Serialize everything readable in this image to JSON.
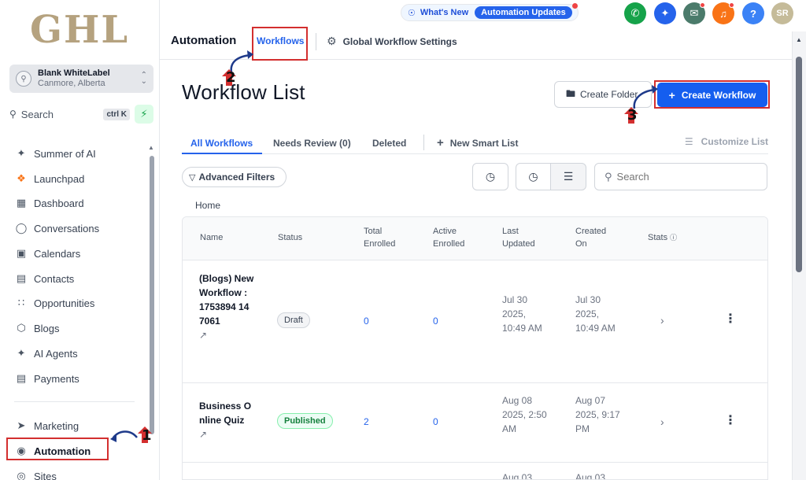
{
  "sidebar": {
    "logo": "GHL",
    "account": {
      "name": "Blank WhiteLabel",
      "location": "Canmore, Alberta"
    },
    "search": {
      "label": "Search",
      "shortcut": "ctrl K"
    },
    "items": [
      {
        "label": "Summer of AI",
        "icon": "sparkle-icon"
      },
      {
        "label": "Launchpad",
        "icon": "rocket-icon"
      },
      {
        "label": "Dashboard",
        "icon": "grid-icon"
      },
      {
        "label": "Conversations",
        "icon": "chat-icon"
      },
      {
        "label": "Calendars",
        "icon": "calendar-icon"
      },
      {
        "label": "Contacts",
        "icon": "contacts-icon"
      },
      {
        "label": "Opportunities",
        "icon": "funnel-icon"
      },
      {
        "label": "Blogs",
        "icon": "cube-icon"
      },
      {
        "label": "AI Agents",
        "icon": "sparkle-icon"
      },
      {
        "label": "Payments",
        "icon": "receipt-icon"
      },
      {
        "label": "Marketing",
        "icon": "send-icon"
      },
      {
        "label": "Automation",
        "icon": "automation-icon"
      },
      {
        "label": "Sites",
        "icon": "globe-icon"
      }
    ]
  },
  "topbar": {
    "whats_new": "What's New",
    "automation_updates": "Automation Updates",
    "avatar_initials": "SR",
    "help": "?",
    "icon_colors": [
      "#16a34a",
      "#2563eb",
      "#4b7b6b",
      "#f97316",
      "#3b82f6",
      "#c5bb99"
    ]
  },
  "tabsbar": {
    "title": "Automation",
    "active_tab": "Workflows",
    "settings": "Global Workflow Settings"
  },
  "main": {
    "title": "Workflow List",
    "create_folder": "Create Folder",
    "create_workflow": "Create Workflow",
    "tabs": [
      "All Workflows",
      "Needs Review (0)",
      "Deleted"
    ],
    "new_smart_list": "New Smart List",
    "customize_list": "Customize List",
    "advanced_filters": "Advanced Filters",
    "search_placeholder": "Search",
    "breadcrumb": "Home"
  },
  "table": {
    "headers": {
      "name": "Name",
      "status": "Status",
      "total1": "Total",
      "total2": "Enrolled",
      "active1": "Active",
      "active2": "Enrolled",
      "last1": "Last",
      "last2": "Updated",
      "created1": "Created",
      "created2": "On",
      "stats": "Stats"
    },
    "rows": [
      {
        "name": "(Blogs) New Workflow : 1753894 147061",
        "status": "Draft",
        "total": "0",
        "active": "0",
        "last_updated": "Jul 30 2025, 10:49 AM",
        "created_on": "Jul 30 2025, 10:49 AM"
      },
      {
        "name": "Business Online Quiz",
        "status": "Published",
        "total": "2",
        "active": "0",
        "last_updated": "Aug 08 2025, 2:50 AM",
        "created_on": "Aug 07 2025, 9:17 PM"
      },
      {
        "name": "",
        "status": "",
        "total": "",
        "active": "",
        "last_updated": "Aug 03",
        "created_on": "Aug 03"
      }
    ]
  },
  "annotations": {
    "step1": "1",
    "step2": "2",
    "step3": "3"
  },
  "colors": {
    "primary": "#155eef",
    "highlight": "#d32f2f",
    "published": "#15803d"
  }
}
